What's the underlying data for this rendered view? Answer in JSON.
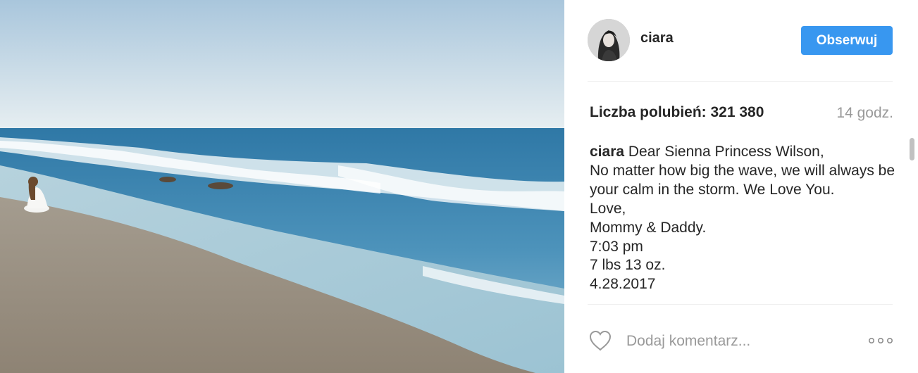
{
  "post": {
    "image_alt": "Kobieta siedząca na plaży nad oceanem",
    "author": {
      "username": "ciara",
      "follow_label": "Obserwuj"
    },
    "likes_text": "Liczba polubień: 321 380",
    "time_ago": "14 godz.",
    "caption": {
      "author": "ciara",
      "text": "Dear Sienna Princess Wilson,\nNo matter how big the wave, we will always be your calm in the storm. We Love You.\nLove,\nMommy & Daddy.\n7:03 pm\n7 lbs 13 oz.\n4.28.2017"
    },
    "comment_placeholder": "Dodaj komentarz...",
    "icons": {
      "like": "heart-outline-icon",
      "more": "more-options-icon"
    }
  },
  "colors": {
    "accent": "#3897f0",
    "muted_text": "#999999",
    "text": "#262626",
    "divider": "#efefef"
  }
}
